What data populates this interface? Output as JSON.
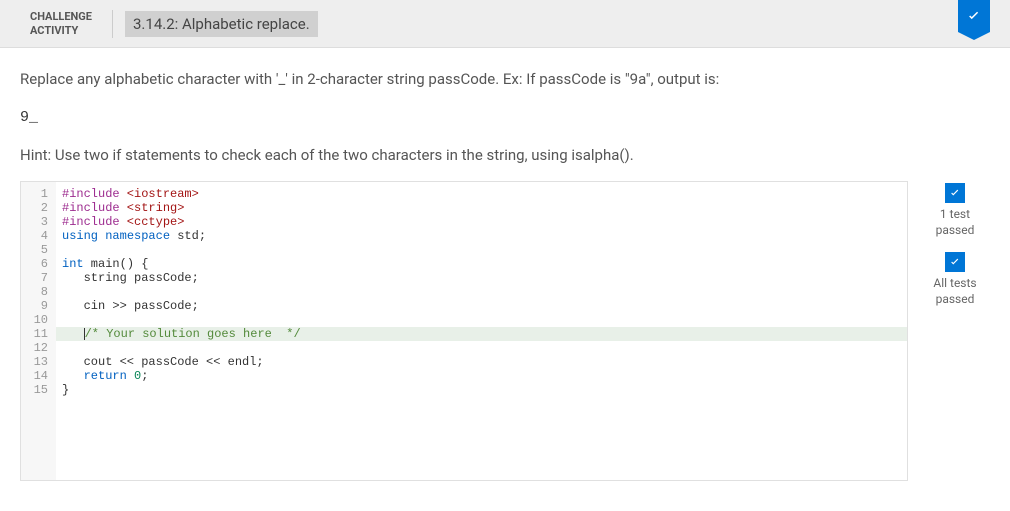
{
  "header": {
    "label_line1": "CHALLENGE",
    "label_line2": "ACTIVITY",
    "title": "3.14.2: Alphabetic replace."
  },
  "prompt": {
    "text": "Replace any alphabetic character with '_' in 2-character string passCode. Ex: If passCode is \"9a\", output is:",
    "example_output": "9_",
    "hint": "Hint: Use two if statements to check each of the two characters in the string, using isalpha()."
  },
  "code": {
    "line_numbers": [
      "1",
      "2",
      "3",
      "4",
      "5",
      "6",
      "7",
      "8",
      "9",
      "10",
      "11",
      "12",
      "13",
      "14",
      "15"
    ],
    "l1_include": "#include",
    "l1_hdr": " <iostream>",
    "l2_include": "#include",
    "l2_hdr": " <string>",
    "l3_include": "#include",
    "l3_hdr": " <cctype>",
    "l4_using": "using",
    "l4_ns": " namespace",
    "l4_std": " std;",
    "l6_int": "int",
    "l6_main": " main() {",
    "l7": "   string passCode;",
    "l9": "   cin >> passCode;",
    "l11_comment": "/* Your solution goes here  */",
    "l13": "   cout << passCode << endl;",
    "l14_ret": "   return",
    "l14_zero": " 0",
    "l14_semi": ";",
    "l15": "}"
  },
  "sidebar": {
    "test1": "1 test passed",
    "test2": "All tests passed"
  }
}
